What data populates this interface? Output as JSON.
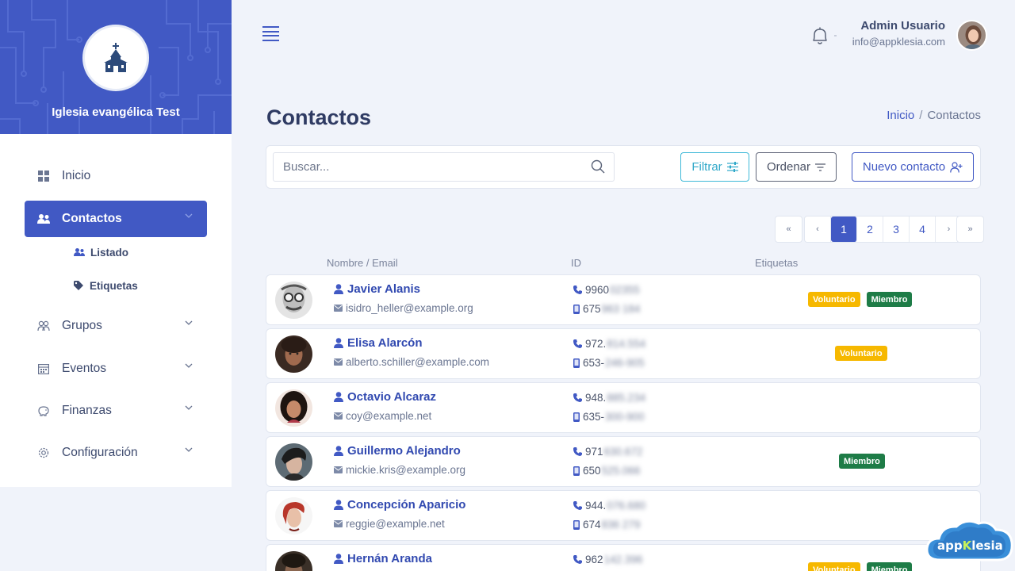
{
  "org": {
    "name": "Iglesia evangélica Test"
  },
  "menu": {
    "inicio": "Inicio",
    "contactos": "Contactos",
    "listado": "Listado",
    "etiquetas": "Etiquetas",
    "grupos": "Grupos",
    "eventos": "Eventos",
    "finanzas": "Finanzas",
    "configuracion": "Configuración"
  },
  "user": {
    "name": "Admin Usuario",
    "email": "info@appklesia.com"
  },
  "page": {
    "title": "Contactos"
  },
  "breadcrumb": {
    "home": "Inicio",
    "separator": "/",
    "current": "Contactos"
  },
  "toolbar": {
    "search_placeholder": "Buscar...",
    "filter_label": "Filtrar",
    "order_label": "Ordenar",
    "new_label": "Nuevo contacto"
  },
  "pagination": {
    "first": "«",
    "prev": "‹",
    "pages": [
      "1",
      "2",
      "3",
      "4"
    ],
    "next": "›",
    "last": "»",
    "current": "1"
  },
  "columns": {
    "name_email": "Nombre / Email",
    "id": "ID",
    "tags": "Etiquetas"
  },
  "tag_labels": {
    "voluntario": "Voluntario",
    "miembro": "Miembro"
  },
  "contacts": [
    {
      "name": "Javier Alanis",
      "email": "isidro_heller@example.org",
      "phone1": "9960",
      "phone1_hidden": "02355",
      "phone2": "675",
      "phone2_hidden": " 963 184"
    },
    {
      "name": "Elisa Alarcón",
      "email": "alberto.schiller@example.com",
      "phone1": "972.",
      "phone1_hidden": "814.554",
      "phone2": "653-",
      "phone2_hidden": "246-905"
    },
    {
      "name": "Octavio Alcaraz",
      "email": "coy@example.net",
      "phone1": "948.",
      "phone1_hidden": "885.234",
      "phone2": "635-",
      "phone2_hidden": "300-900"
    },
    {
      "name": "Guillermo Alejandro",
      "email": "mickie.kris@example.org",
      "phone1": "971",
      "phone1_hidden": " 630.672",
      "phone2": "650",
      "phone2_hidden": " 525.066"
    },
    {
      "name": "Concepción Aparicio",
      "email": "reggie@example.net",
      "phone1": "944.",
      "phone1_hidden": "076.680",
      "phone2": "674",
      "phone2_hidden": " 836 279"
    },
    {
      "name": "Hernán Aranda",
      "email": "",
      "phone1": "962",
      "phone1_hidden": " 142.396",
      "phone2": "",
      "phone2_hidden": ""
    }
  ],
  "brand": {
    "prefix": "app",
    "highlight": "K",
    "suffix": "lesia"
  },
  "colors": {
    "primary": "#4159c4",
    "voluntario": "#f6b800",
    "miembro": "#1e7c47",
    "filter": "#3fb9d8"
  }
}
